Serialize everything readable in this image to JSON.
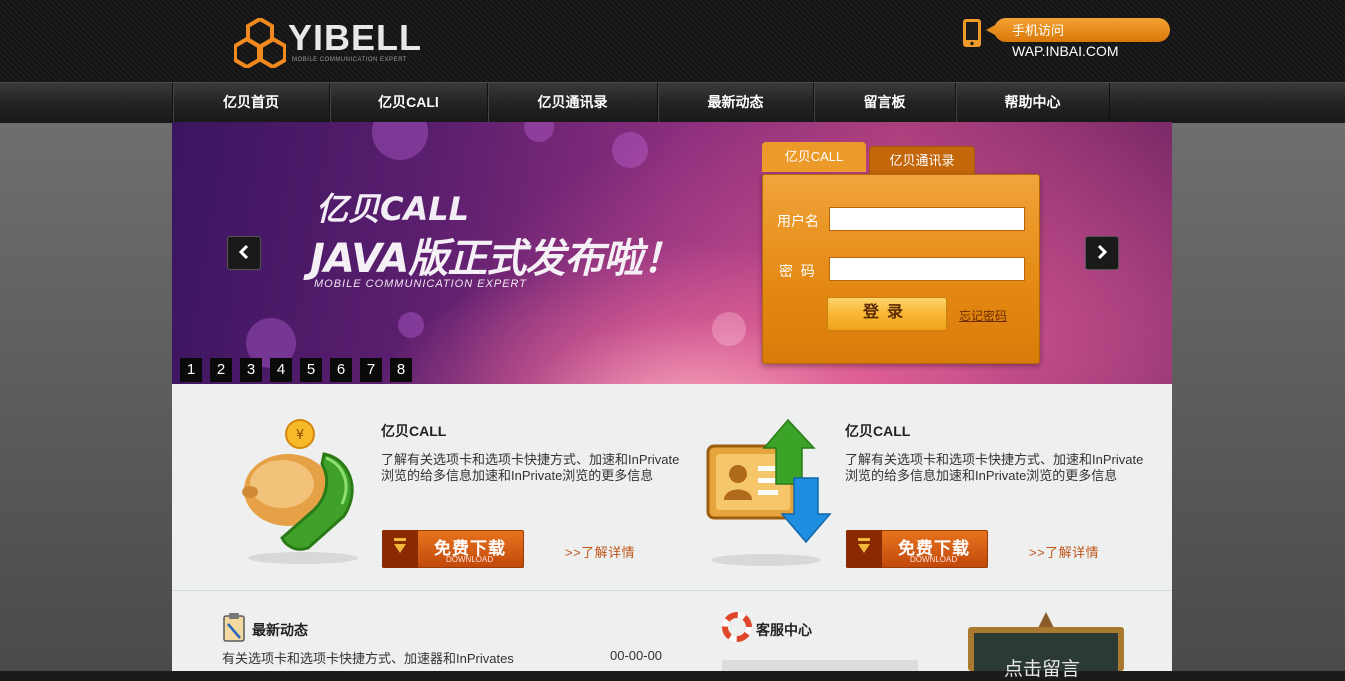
{
  "header": {
    "logo_text": "YIBELL",
    "logo_subtitle": "MOBILE COMMUNICATION EXPERT",
    "mobile_label": "手机访问",
    "mobile_url": "WAP.INBAI.COM"
  },
  "nav": {
    "items": [
      {
        "label": "亿贝首页"
      },
      {
        "label": "亿贝CALl"
      },
      {
        "label": "亿贝通讯录"
      },
      {
        "label": "最新动态"
      },
      {
        "label": "留言板"
      },
      {
        "label": "帮助中心"
      }
    ]
  },
  "banner": {
    "title_line1": "亿贝CALL",
    "title_line2": "JAVA版正式发布啦！",
    "subtitle": "MOBILE COMMUNICATION EXPERT",
    "prev_icon": "chevron-left-icon",
    "next_icon": "chevron-right-icon",
    "slides": [
      "1",
      "2",
      "3",
      "4",
      "5",
      "6",
      "7",
      "8"
    ]
  },
  "login": {
    "tab_active": "亿贝CALL",
    "tab_inactive": "亿贝通讯录",
    "username_label": "用户名",
    "password_label": "密  码",
    "username_value": "",
    "password_value": "",
    "submit_label": "登录",
    "forgot_label": "忘记密码"
  },
  "promos": [
    {
      "title": "亿贝CALL",
      "text": "了解有关选项卡和选项卡快捷方式、加速和InPrivate 浏览的给多信息加速和InPrivate浏览的更多信息",
      "download_label": "免费下载",
      "download_sub": "DOWNLOAD",
      "more_label": ">>了解详情",
      "icon": "piggy-phone-icon"
    },
    {
      "title": "亿贝CALL",
      "text": "了解有关选项卡和选项卡快捷方式、加速和InPrivate 浏览的给多信息加速和InPrivate浏览的更多信息",
      "download_label": "免费下载",
      "download_sub": "DOWNLOAD",
      "more_label": ">>了解详情",
      "icon": "contact-card-icon"
    }
  ],
  "news": {
    "title": "最新动态",
    "item_text": "有关选项卡和选项卡快捷方式、加速器和InPrivates",
    "item_date": "00-00-00"
  },
  "service": {
    "title": "客服中心"
  },
  "board": {
    "text": "点击留言"
  },
  "colors": {
    "accent_orange": "#e48813",
    "download_orange": "#c0480a",
    "nav_dark": "#232323"
  }
}
